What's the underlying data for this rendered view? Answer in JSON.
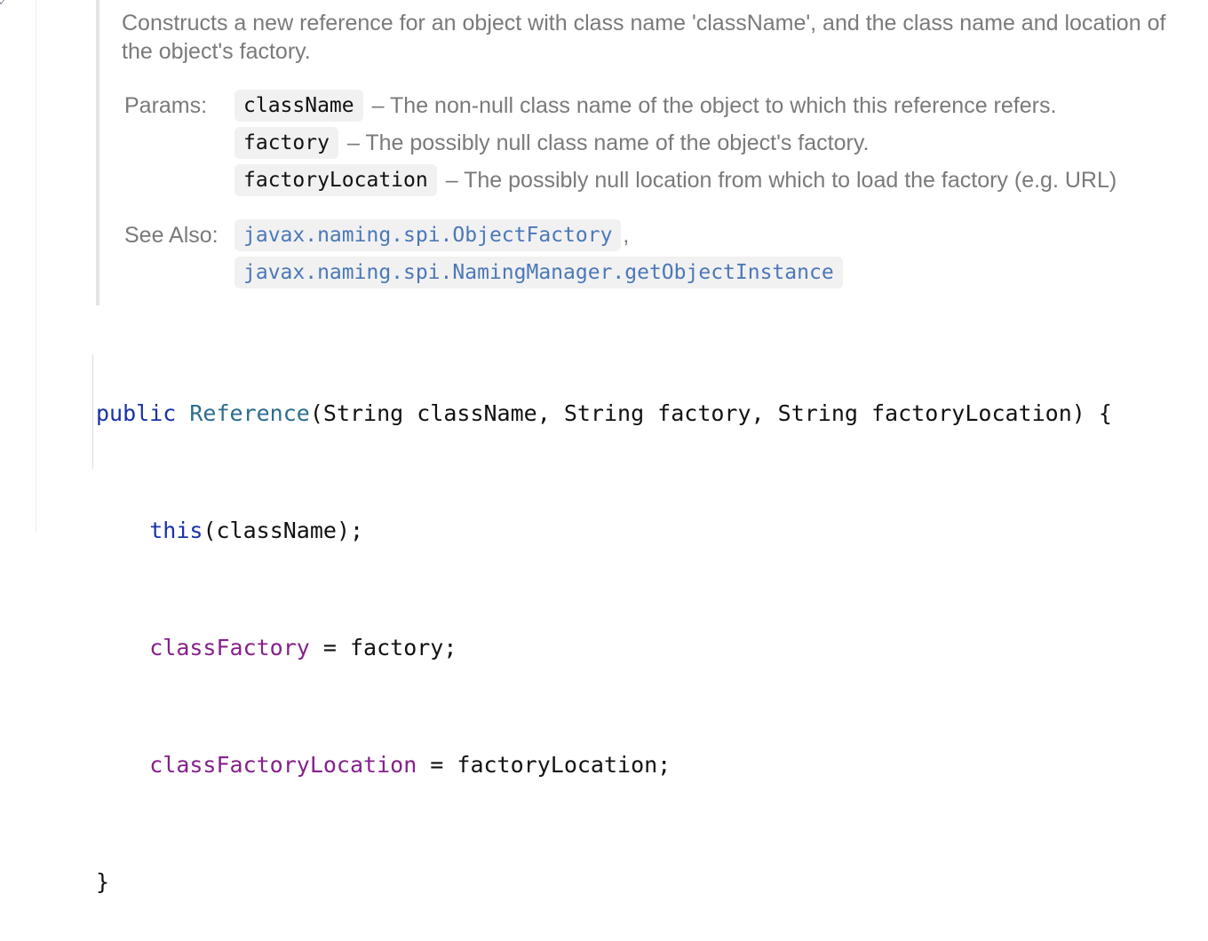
{
  "doc": {
    "description": "Constructs a new reference for an object with class name 'className', and the class name and location of the object's factory.",
    "params_label": "Params:",
    "params": [
      {
        "name": "className",
        "desc": "– The non-null class name of the object to which this reference refers."
      },
      {
        "name": "factory",
        "desc": "– The possibly null class name of the object's factory."
      },
      {
        "name": "factoryLocation",
        "desc": "– The possibly null location from which to load the factory (e.g. URL)"
      }
    ],
    "see_also_label": "See Also:",
    "see_also": [
      {
        "text": "javax.naming.spi.ObjectFactory",
        "sep": ","
      },
      {
        "text": "javax.naming.spi.NamingManager.getObjectInstance",
        "sep": ""
      }
    ]
  },
  "code": {
    "line1": {
      "kw": "public",
      "cls": "Reference",
      "rest": "(String className, String factory, String factoryLocation) {"
    },
    "line2": {
      "indent": "    ",
      "kw": "this",
      "rest": "(className);"
    },
    "line3": {
      "indent": "    ",
      "field": "classFactory",
      "rest": " = factory;"
    },
    "line4": {
      "indent": "    ",
      "field": "classFactoryLocation",
      "rest": " = factoryLocation;"
    },
    "line5": {
      "text": "}"
    }
  },
  "colors": {
    "keyword": "#1a32a8",
    "class_ref": "#2c6e8e",
    "field": "#86208c",
    "link": "#4b78b8",
    "doc_text": "#7a7a7a"
  }
}
